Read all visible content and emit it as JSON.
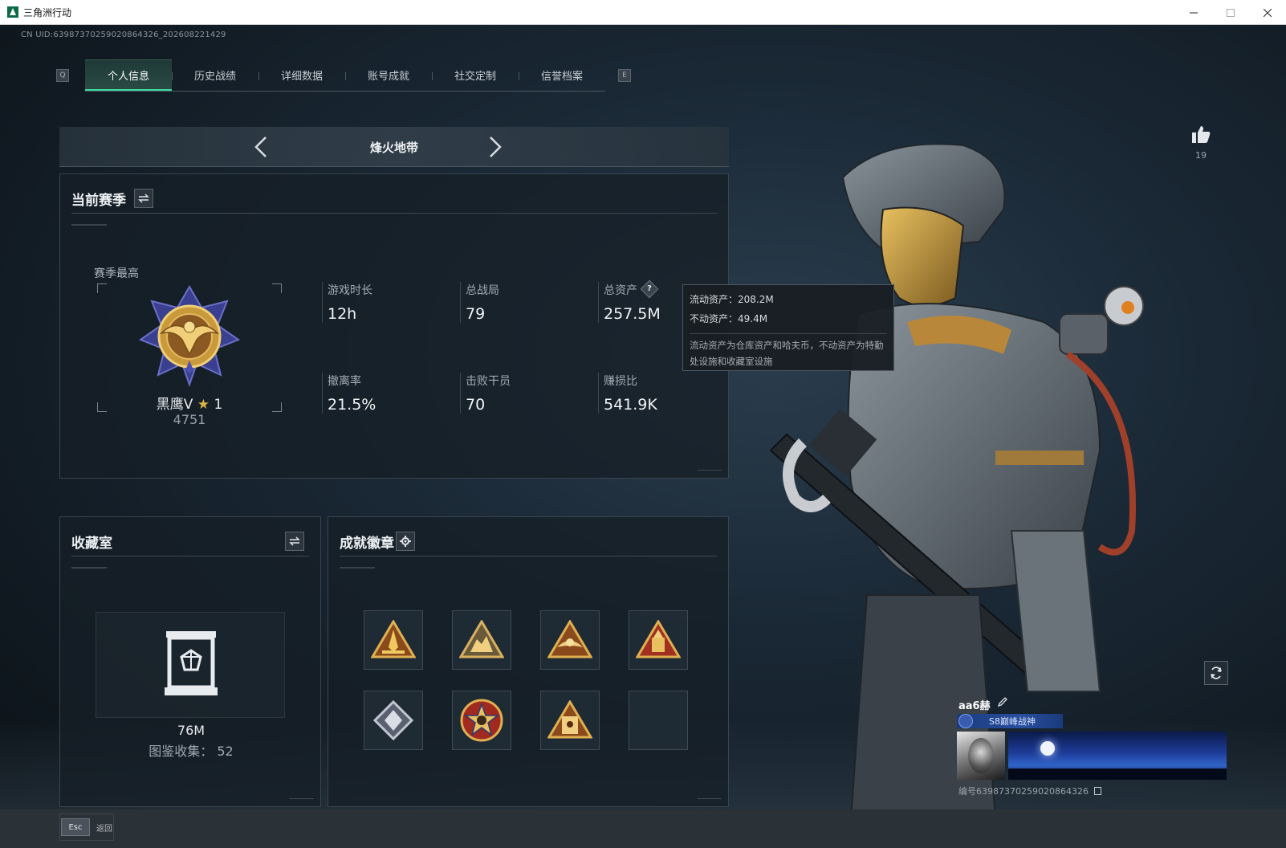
{
  "window": {
    "title": "三角洲行动",
    "icon": "app-triangle-icon"
  },
  "uid_text": "CN UID:639873702590208643​26_202608221429",
  "tabs": {
    "left_key": "Q",
    "right_key": "E",
    "items": [
      {
        "label": "个人信息",
        "active": true
      },
      {
        "label": "历史战绩",
        "active": false
      },
      {
        "label": "详细数据",
        "active": false
      },
      {
        "label": "账号成就",
        "active": false
      },
      {
        "label": "社交定制",
        "active": false
      },
      {
        "label": "信誉档案",
        "active": false
      }
    ]
  },
  "map_selector": {
    "title": "烽火地带"
  },
  "season": {
    "title": "当前赛季",
    "best_label": "赛季最高",
    "rank_name": "黑鹰V",
    "rank_star_count": "1",
    "rank_score": "4751",
    "stats": [
      {
        "label": "游戏时长",
        "value": "12h"
      },
      {
        "label": "总战局",
        "value": "79"
      },
      {
        "label": "总资产",
        "value": "257.5M",
        "help": true
      },
      {
        "label": "撤离率",
        "value": "21.5%"
      },
      {
        "label": "击败干员",
        "value": "70"
      },
      {
        "label": "赚损比",
        "value": "541.9K"
      }
    ]
  },
  "tooltip": {
    "liquid": "流动资产：208.2M",
    "fixed": "不动资产：49.4M",
    "note": "流动资产为仓库资产和哈夫币，不动资产为特勤处设施和收藏室设施"
  },
  "collection": {
    "title": "收藏室",
    "value": "76M",
    "count_label": "图鉴收集：",
    "count": "52"
  },
  "badges": {
    "title": "成就徽章",
    "items": [
      {
        "icon": "gold-triangle-rocket-badge-icon"
      },
      {
        "icon": "gold-triangle-beast-badge-icon"
      },
      {
        "icon": "gold-triangle-wings-badge-icon"
      },
      {
        "icon": "gold-triangle-red-badge-icon"
      },
      {
        "icon": "silver-diamond-badge-icon"
      },
      {
        "icon": "gold-star-medal-badge-icon"
      },
      {
        "icon": "gold-triangle-tower-badge-icon"
      },
      {
        "icon": "empty-badge-slot"
      }
    ]
  },
  "likes": {
    "count": "19"
  },
  "profile": {
    "name": "aa6赫",
    "title_badge": "S8巅峰战神",
    "id_text": "编号639873702590208643​26"
  },
  "footer": {
    "esc_key": "Esc",
    "esc_label": "返回"
  },
  "colors": {
    "accent": "#3fdca0",
    "gold": "#d9b24a",
    "background": "#111a22"
  }
}
